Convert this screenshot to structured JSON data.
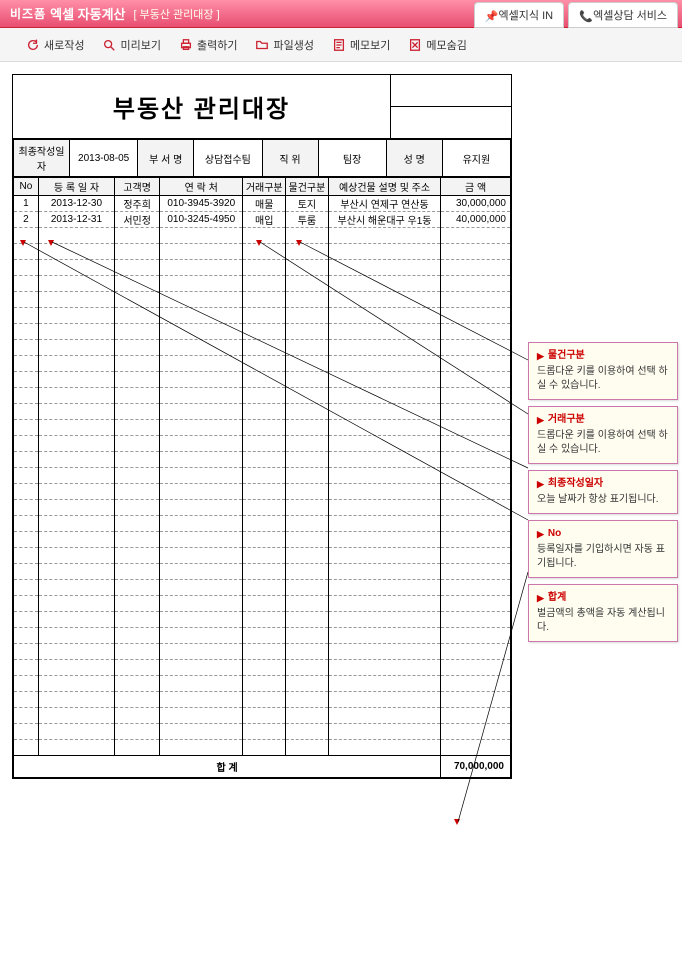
{
  "header": {
    "brand_prefix": "비즈폼",
    "brand": "엑셀 자동계산",
    "subtitle": "[ 부동산 관리대장 ]",
    "tabs": [
      {
        "label": "엑셀지식 IN"
      },
      {
        "label": "엑셀상담 서비스"
      }
    ]
  },
  "toolbar": [
    {
      "id": "new",
      "label": "새로작성"
    },
    {
      "id": "preview",
      "label": "미리보기"
    },
    {
      "id": "print",
      "label": "출력하기"
    },
    {
      "id": "file",
      "label": "파일생성"
    },
    {
      "id": "memo-view",
      "label": "메모보기"
    },
    {
      "id": "memo-hide",
      "label": "메모숨김"
    }
  ],
  "doc": {
    "title": "부동산 관리대장",
    "meta": {
      "labels": {
        "last_date": "최종작성일자",
        "dept": "부 서 명",
        "team": "상담접수팀",
        "pos": "직   위",
        "leader": "팀장",
        "name": "성   명"
      },
      "values": {
        "last_date": "2013-08-05",
        "dept": "",
        "team": "",
        "pos": "",
        "leader": "",
        "name": "유지원"
      }
    },
    "columns": {
      "no": "No",
      "date": "등 록 일 자",
      "cust": "고객명",
      "tel": "연 락 처",
      "tt": "거래구분",
      "pt": "물건구분",
      "desc": "예상건물 설명 및 주소",
      "amt": "금  액"
    },
    "rows": [
      {
        "no": "1",
        "date": "2013-12-30",
        "cust": "정주희",
        "tel": "010-3945-3920",
        "tt": "매물",
        "pt": "토지",
        "desc": "부산시 연제구 연산동",
        "amt": "30,000,000"
      },
      {
        "no": "2",
        "date": "2013-12-31",
        "cust": "서민정",
        "tel": "010-3245-4950",
        "tt": "매입",
        "pt": "투룸",
        "desc": "부산시 해운대구 우1동",
        "amt": "40,000,000"
      }
    ],
    "empty_rows": 33,
    "footer": {
      "label": "합        계",
      "total": "70,000,000"
    }
  },
  "callouts": [
    {
      "title": "물건구분",
      "desc": "드롭다운 키를 이용하여\n선택 하실 수 있습니다."
    },
    {
      "title": "거래구분",
      "desc": "드롭다운 키를 이용하여\n선택 하실 수 있습니다."
    },
    {
      "title": "최종작성일자",
      "desc": "오늘 날짜가 항상\n표기됩니다."
    },
    {
      "title": "No",
      "desc": "등록일자를 기입하시면\n자동 표기됩니다."
    },
    {
      "title": "합계",
      "desc": "벌금액의 총액을\n자동 계산됩니다."
    }
  ]
}
